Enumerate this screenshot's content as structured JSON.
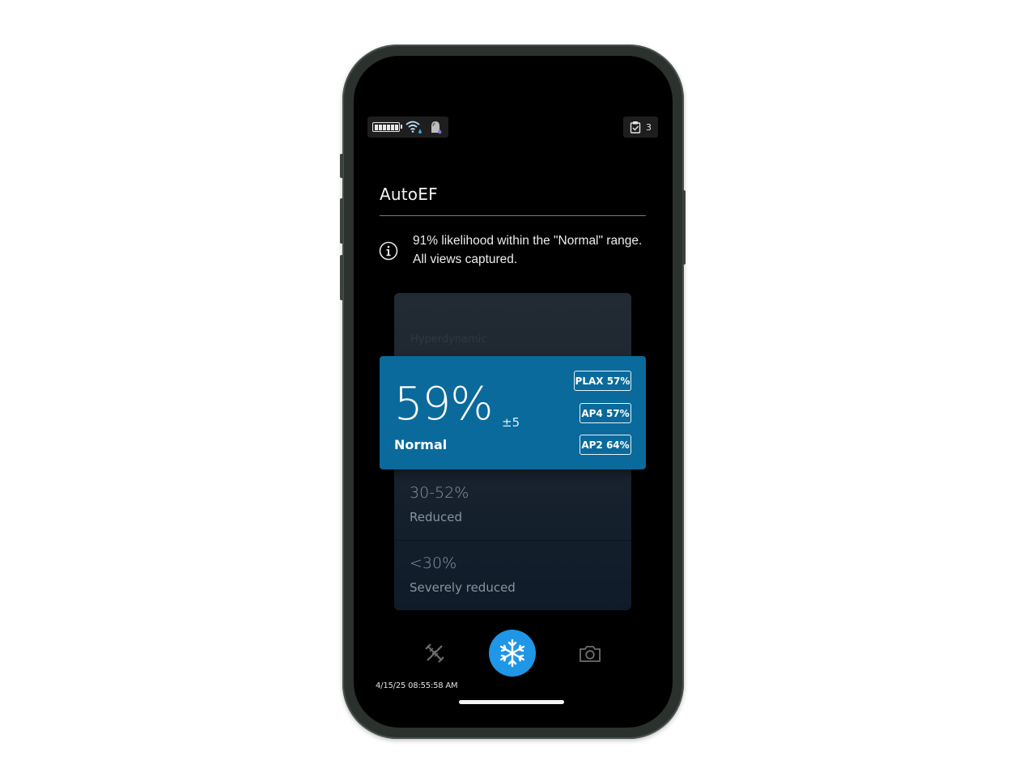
{
  "status": {
    "clip_count": "3"
  },
  "screen": {
    "title": "AutoEF",
    "info_message": "91% likelihood within the \"Normal\" range. All views captured."
  },
  "result": {
    "ef_value": "59%",
    "tolerance": "±5",
    "category": "Normal",
    "views": [
      {
        "label": "PLAX 57%"
      },
      {
        "label": "AP4 57%"
      },
      {
        "label": "AP2 64%"
      }
    ]
  },
  "ranges": {
    "top_hidden_label": "Hyperdynamic",
    "reduced": {
      "value": "30-52%",
      "label": "Reduced"
    },
    "severe": {
      "value": "<30%",
      "label": "Severely reduced"
    }
  },
  "controls": {
    "freeze_icon": "snowflake-icon",
    "measure_icon": "caliper-icon",
    "capture_icon": "camera-icon"
  },
  "footer": {
    "timestamp": "4/15/25 08:55:58 AM"
  },
  "colors": {
    "result_card": "#0a6a9c",
    "freeze_button": "#1f96e6",
    "screen_bg": "#000000"
  }
}
